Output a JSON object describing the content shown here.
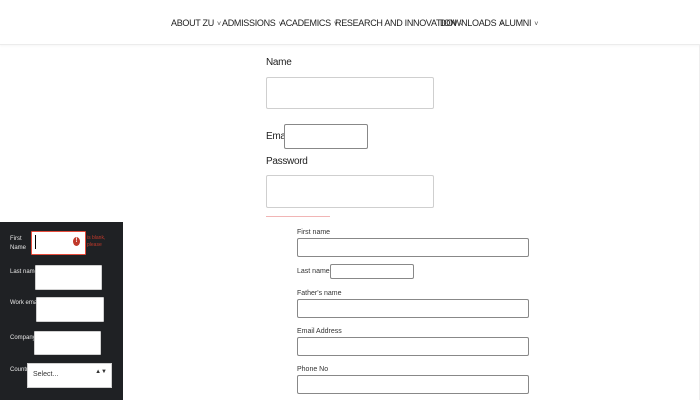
{
  "nav": {
    "items": [
      {
        "label": "ABOUT ZU"
      },
      {
        "label": "ADMISSIONS"
      },
      {
        "label": "ACADEMICS"
      },
      {
        "label": "RESEARCH AND INNOVATION"
      },
      {
        "label": "DOWNLOADS"
      },
      {
        "label": "ALUMNI"
      }
    ],
    "chevron": "˅"
  },
  "form1": {
    "name_label": "Name",
    "email_label": "Email",
    "password_label": "Password"
  },
  "form2": {
    "first_name_label": "First name",
    "last_name_label": "Last name",
    "fathers_name_label": "Father's name",
    "email_address_label": "Email Address",
    "phone_label": "Phone No"
  },
  "side_panel": {
    "first_name_label": "First Name",
    "last_name_label": "Last name",
    "work_email_label": "Work email",
    "company_label": "Company",
    "country_label": "Country",
    "error_message": "is blank, please",
    "select_placeholder": "Select...",
    "select_arrows": "▲▼",
    "error_icon": "!",
    "colors": {
      "panel_bg": "#1f2124",
      "error": "#c0392b"
    }
  }
}
